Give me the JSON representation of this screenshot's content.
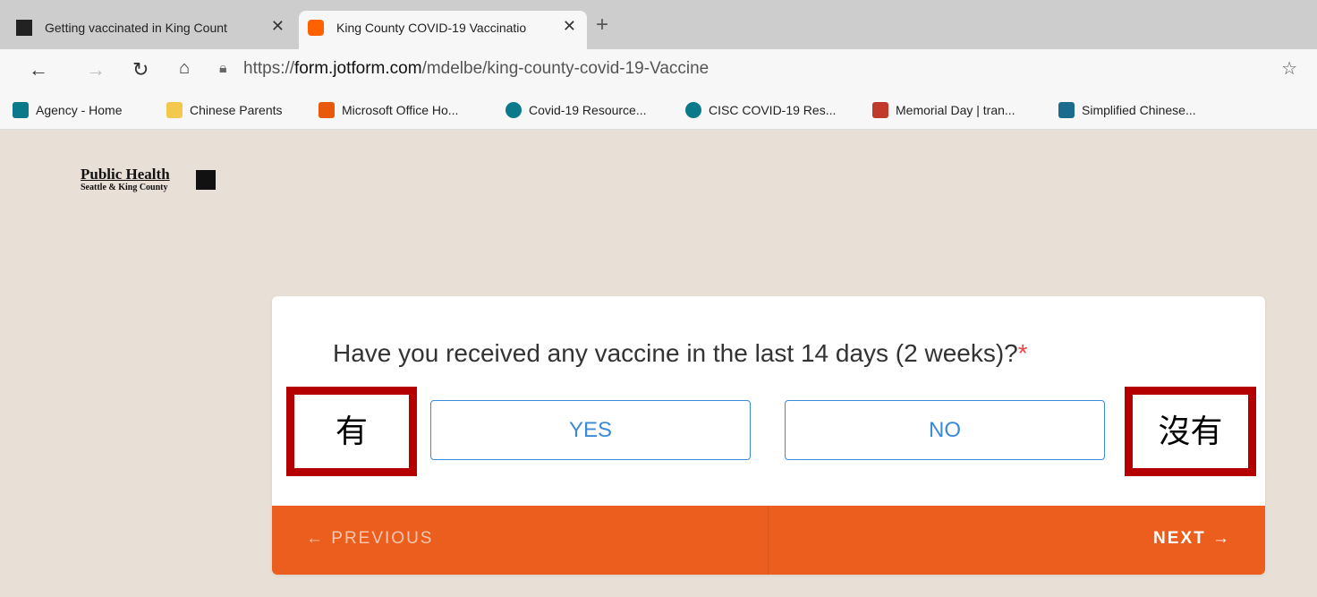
{
  "tabs": [
    {
      "title": "Getting vaccinated in King Count",
      "icon": "public-health-favicon"
    },
    {
      "title": "King County COVID-19 Vaccinatio",
      "icon": "jotform-favicon"
    }
  ],
  "address_bar": {
    "url_prefix": "https://",
    "url_host": "form.jotform.com",
    "url_path": "/mdelbe/king-county-covid-19-Vaccine"
  },
  "bookmarks": [
    {
      "label": "Agency - Home",
      "icon": "sharepoint-icon",
      "color": "#0a7a8a"
    },
    {
      "label": "Chinese Parents",
      "icon": "folder-icon",
      "color": "#f2c94c"
    },
    {
      "label": "Microsoft Office Ho...",
      "icon": "office-icon",
      "color": "#e8590c"
    },
    {
      "label": "Covid-19 Resource...",
      "icon": "sharepoint-icon",
      "color": "#0a7a8a"
    },
    {
      "label": "CISC COVID-19 Res...",
      "icon": "sharepoint-icon",
      "color": "#0a7a8a"
    },
    {
      "label": "Memorial Day | tran...",
      "icon": "shield-icon",
      "color": "#c0392b"
    },
    {
      "label": "Simplified Chinese...",
      "icon": "translate-icon",
      "color": "#1b6b8f"
    }
  ],
  "logo": {
    "main": "Public Health",
    "sub": "Seattle & King County"
  },
  "form": {
    "question": "Have you received any vaccine in the last 14 days (2 weeks)?",
    "required_mark": "*",
    "yes_label": "YES",
    "no_label": "NO",
    "previous_label": "← PREVIOUS",
    "next_label": "NEXT →"
  },
  "annotations": {
    "yes_translation": "有",
    "no_translation": "沒有"
  },
  "colors": {
    "accent_orange": "#ec5e1e",
    "choice_blue": "#3b8ad8",
    "annotation_red": "#b40000"
  }
}
